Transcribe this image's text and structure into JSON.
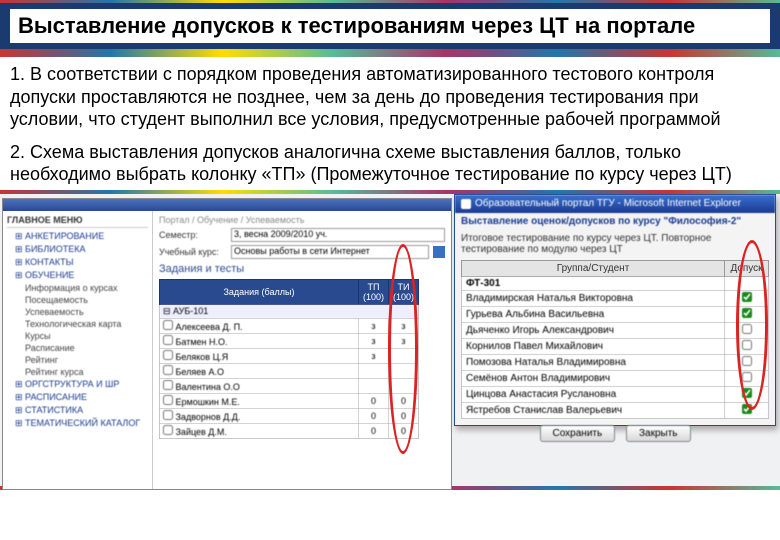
{
  "slide": {
    "title": "Выставление допусков к тестированиям через ЦТ на портале",
    "para1": "1. В соответствии с порядком проведения автоматизированного тестового контроля допуски проставляются не позднее, чем за день до проведения тестирования при условии, что  студент выполнил все условия, предусмотренные рабочей программой",
    "para2": "2. Схема выставления допусков аналогична схеме выставления баллов, только необходимо выбрать колонку «ТП» (Промежуточное тестирование по курсу через ЦТ)"
  },
  "portal": {
    "sidebar_header": "ГЛАВНОЕ МЕНЮ",
    "sidebar_items": [
      "АНКЕТИРОВАНИЕ",
      "БИБЛИОТЕКА",
      "КОНТАКТЫ",
      "ОБУЧЕНИЕ"
    ],
    "sidebar_sub": [
      "Информация о курсах",
      "Посещаемость",
      "Успеваемость",
      "Технологическая карта",
      "Курсы",
      "Расписание",
      "Рейтинг",
      "Рейтинг курса"
    ],
    "sidebar_items2": [
      "ОРГСТРУКТУРА И ШР",
      "РАСПИСАНИЕ",
      "СТАТИСТИКА",
      "ТЕМАТИЧЕСКИЙ КАТАЛОГ"
    ],
    "crumb": "Портал / Обучение / Успеваемость",
    "label_semester": "Семестр:",
    "val_semester": "3, весна 2009/2010 уч.",
    "label_course": "Учебный курс:",
    "val_course": "Основы работы в сети Интернет",
    "section": "Задания и тесты",
    "th_tasks": "Задания (баллы)",
    "th_tp": "ТП (100)",
    "th_ti": "ТИ (100)",
    "group_row": "АУБ-101",
    "students": [
      "Алексеева Д. П.",
      "Батмен Н.О.",
      "Беляков Ц.Я",
      "Беляев А.О",
      "Валентина О.О",
      "Ермошкин М.Е.",
      "Задворнов Д.Д.",
      "Зайцев Д.М."
    ],
    "tp_vals": [
      "з",
      "з",
      "з",
      "",
      "",
      "0",
      "0",
      "0"
    ],
    "ti_vals": [
      "з",
      "з",
      "",
      "",
      "",
      "0",
      "0",
      "0"
    ]
  },
  "iewin": {
    "title": "Образовательный портал ТГУ - Microsoft Internet Explorer",
    "hdr1": "Выставление оценок/допусков по курсу \"Философия-2\"",
    "hdr2": "Итоговое тестирование по курсу через ЦТ. Повторное тестирование по модулю через ЦТ",
    "col1": "Группа/Студент",
    "col2": "Допуск",
    "group": "ФТ-301",
    "students": [
      {
        "name": "Владимирская Наталья Викторовна",
        "ck": true
      },
      {
        "name": "Гурьева Альбина Васильевна",
        "ck": true
      },
      {
        "name": "Дьяченко Игорь Александрович",
        "ck": false
      },
      {
        "name": "Корнилов Павел Михайлович",
        "ck": false
      },
      {
        "name": "Помозова Наталья Владимировна",
        "ck": false
      },
      {
        "name": "Семёнов Антон Владимирович",
        "ck": false
      },
      {
        "name": "Цинцова Анастасия Руслановна",
        "ck": true
      },
      {
        "name": "Ястребов Станислав Валерьевич",
        "ck": true
      }
    ],
    "btn_save": "Сохранить",
    "btn_close": "Закрыть"
  }
}
